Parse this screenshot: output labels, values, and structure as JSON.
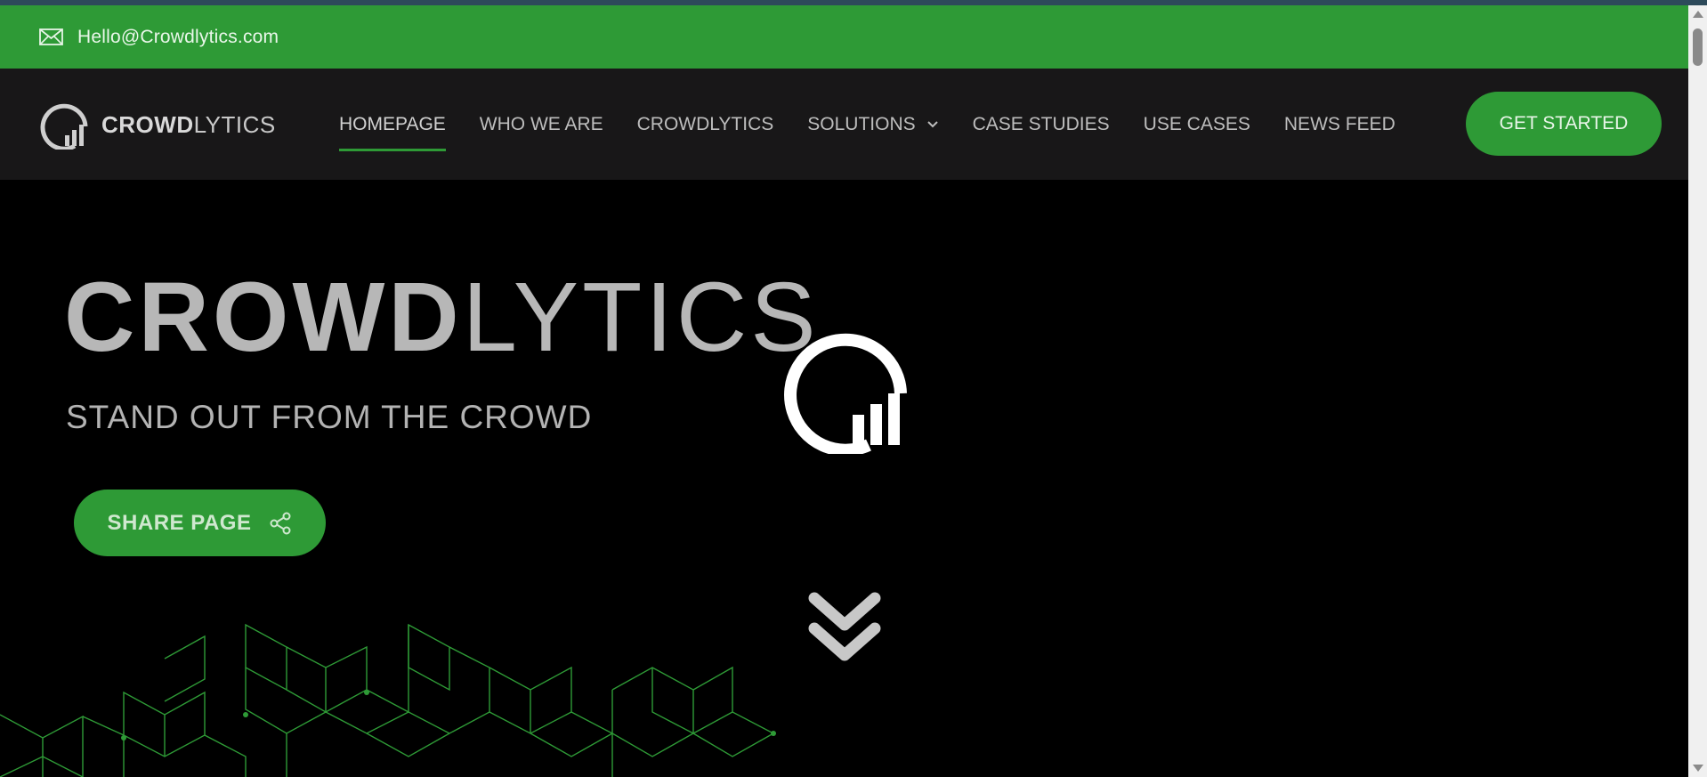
{
  "topbar": {
    "email": "Hello@Crowdlytics.com",
    "icon": "mail-icon",
    "background": "#2e9a36"
  },
  "logo": {
    "bold": "CROWD",
    "light": "LYTICS"
  },
  "nav": {
    "items": [
      {
        "label": "HOMEPAGE",
        "active": true
      },
      {
        "label": "WHO WE ARE"
      },
      {
        "label": "CROWDLYTICS"
      },
      {
        "label": "SOLUTIONS",
        "has_dropdown": true
      },
      {
        "label": "CASE STUDIES"
      },
      {
        "label": "USE CASES"
      },
      {
        "label": "NEWS FEED"
      }
    ],
    "cta_label": "GET STARTED"
  },
  "hero": {
    "title_bold": "CROWD",
    "title_light": "LYTICS",
    "tagline": "STAND OUT FROM THE CROWD",
    "share_label": "SHARE PAGE"
  },
  "colors": {
    "accent": "#2e9a36",
    "nav_bg": "#181718",
    "hero_bg": "#000000",
    "text_light": "#b7b7b7"
  }
}
